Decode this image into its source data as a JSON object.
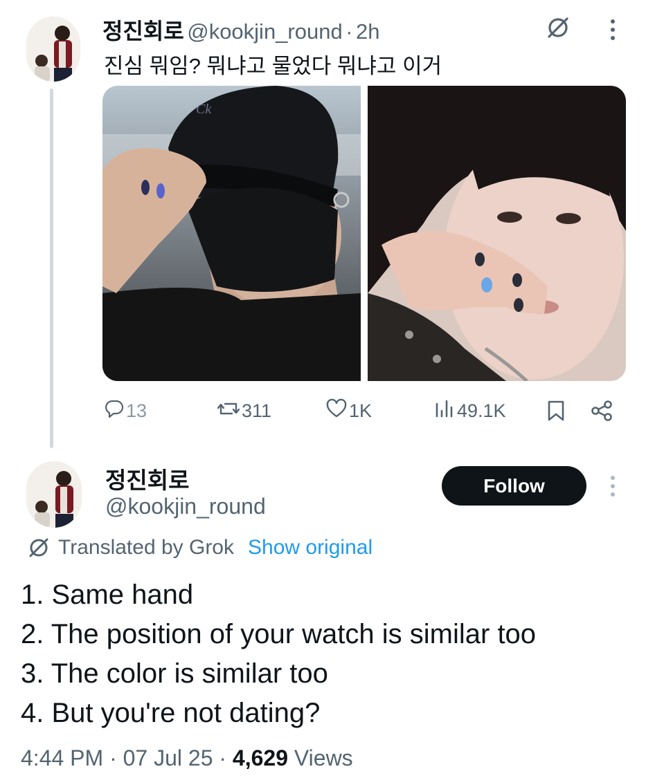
{
  "quoted_tweet": {
    "display_name": "정진회로",
    "handle": "@kookjin_round",
    "separator": "·",
    "time": "2h",
    "text": "진심 뭐임? 뭐냐고 물었다 뭐냐고 이거",
    "actions": {
      "replies": "13",
      "reposts": "311",
      "likes": "1K",
      "views": "49.1K"
    }
  },
  "main_tweet": {
    "display_name": "정진회로",
    "handle": "@kookjin_round",
    "follow_label": "Follow",
    "translated_label": "Translated by Grok",
    "show_original_label": "Show original",
    "lines": [
      "1. Same hand",
      "2. The position of your watch is similar too",
      "3. The color is similar too",
      "4. But you're not dating?"
    ],
    "time": "4:44 PM",
    "date": "07 Jul 25",
    "views_count": "4,629",
    "views_label": "Views"
  },
  "colors": {
    "text_primary": "#0f1419",
    "text_secondary": "#536471",
    "accent_blue": "#1d9bf0",
    "follow_bg": "#0f1419",
    "thread_line": "#cfd9de"
  },
  "icons": [
    "grok-icon",
    "more-icon",
    "reply-icon",
    "repost-icon",
    "like-icon",
    "views-icon",
    "bookmark-icon",
    "share-icon"
  ]
}
